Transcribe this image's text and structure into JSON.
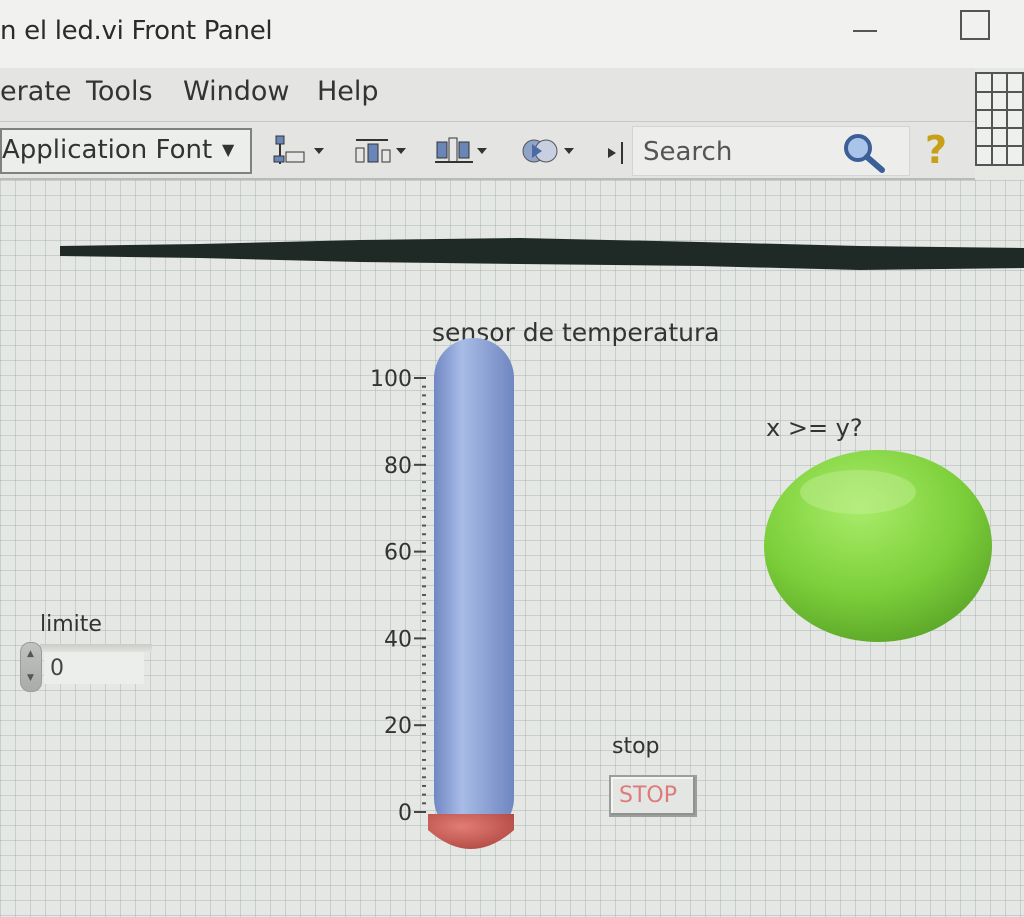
{
  "window": {
    "title": "n el led.vi Front Panel"
  },
  "menu": {
    "items": [
      "erate",
      "Tools",
      "Window",
      "Help"
    ]
  },
  "toolbar": {
    "font_selector": "Application Font",
    "search_placeholder": "Search",
    "tools": [
      "align-objects-icon",
      "distribute-objects-icon",
      "resize-objects-icon",
      "reorder-icon"
    ]
  },
  "panel": {
    "thermometer": {
      "label": "sensor de temperatura",
      "scale_ticks": [
        "100",
        "80",
        "60",
        "40",
        "20",
        "0"
      ],
      "value": 0,
      "min": 0,
      "max": 100
    },
    "led": {
      "label": "x >= y?",
      "state": "on",
      "color": "#7ccf3a"
    },
    "numeric_control": {
      "label": "limite",
      "value": "0"
    },
    "stop_button": {
      "label": "stop",
      "text": "STOP"
    }
  },
  "colors": {
    "thermo_tube": "#8ea6d8",
    "thermo_bulb": "#c95a55",
    "led_on": "#7ccf3a",
    "stop_text": "#e07a7a"
  }
}
